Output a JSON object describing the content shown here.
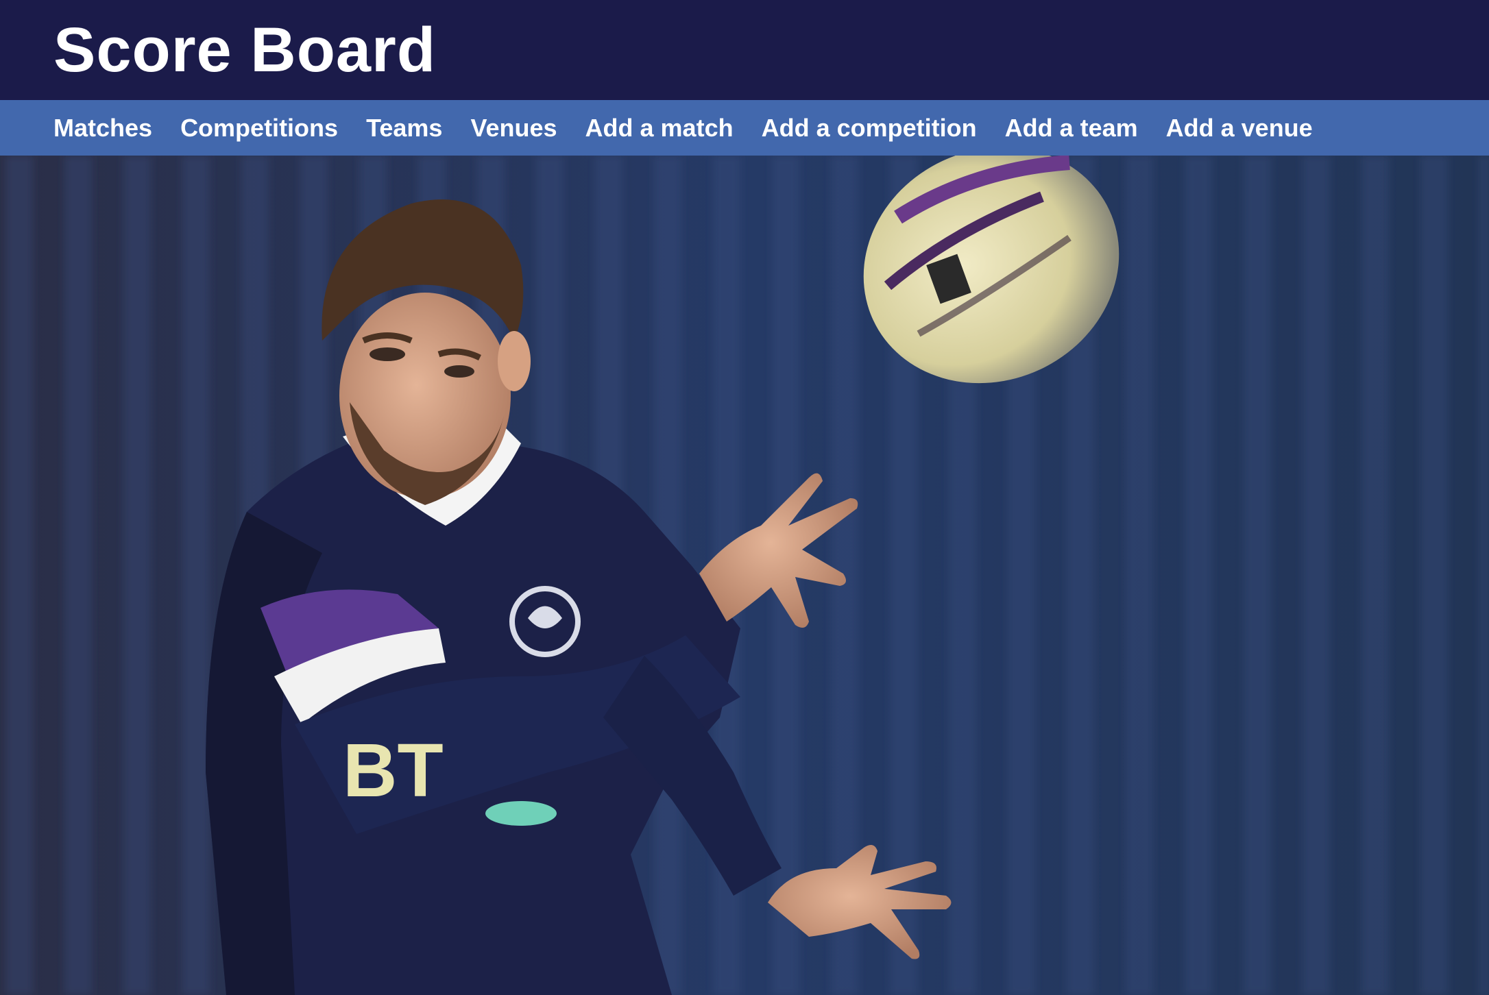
{
  "header": {
    "title": "Score Board"
  },
  "nav": {
    "items": [
      {
        "label": "Matches"
      },
      {
        "label": "Competitions"
      },
      {
        "label": "Teams"
      },
      {
        "label": "Venues"
      },
      {
        "label": "Add a match"
      },
      {
        "label": "Add a competition"
      },
      {
        "label": "Add a team"
      },
      {
        "label": "Add a venue"
      }
    ]
  },
  "colors": {
    "header_bg": "#1b1b4a",
    "nav_bg": "#4268ad",
    "text": "#ffffff"
  },
  "hero": {
    "image": "rugby-player-passing-ball-photo"
  }
}
